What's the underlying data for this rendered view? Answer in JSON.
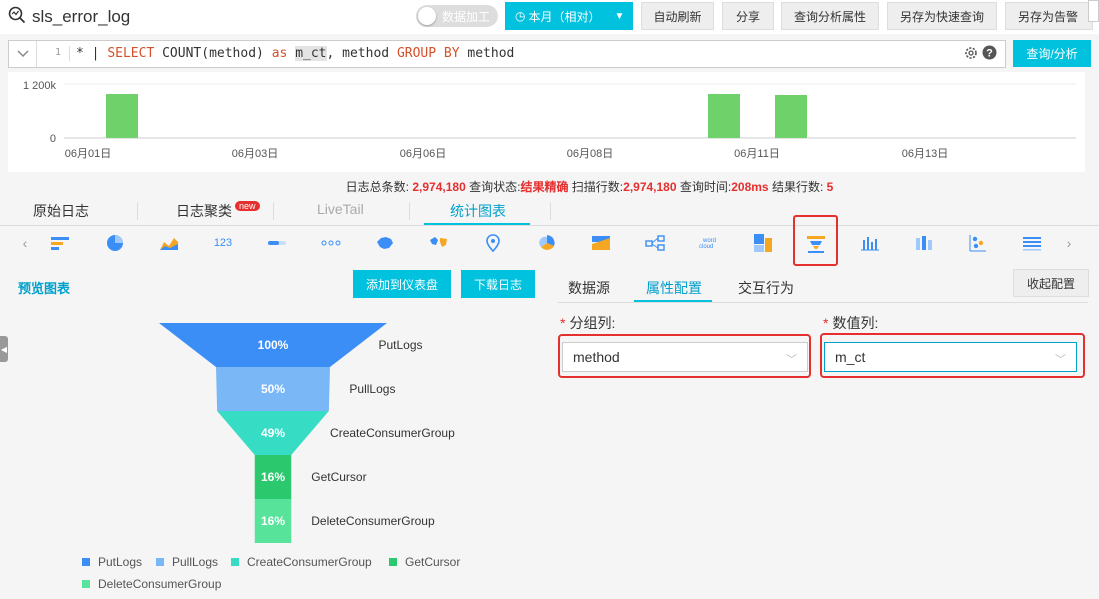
{
  "app": {
    "logstore_name": "sls_error_log",
    "data_process_label": "数据加工",
    "time_range_label": "本月（相对）",
    "buttons": {
      "auto_refresh": "自动刷新",
      "share": "分享",
      "query_props": "查询分析属性",
      "save_quick_query": "另存为快速查询",
      "save_alert": "另存为告警"
    }
  },
  "query": {
    "line_number": "1",
    "parts": {
      "star": "* | ",
      "select": "SELECT ",
      "count": "COUNT",
      "method_arg": "(method) ",
      "as": "as",
      "space1": " ",
      "alias": "m_ct",
      "rest": ", method ",
      "groupby": "GROUP BY",
      "tail": " method"
    },
    "submit_label": "查询/分析"
  },
  "histogram": {
    "y_ticks": [
      "1 200k",
      "0"
    ],
    "x_ticks": [
      "06月01日",
      "06月03日",
      "06月06日",
      "06月08日",
      "06月11日",
      "06月13日"
    ],
    "bar_color": "#6fd16a"
  },
  "summary": {
    "total_label": "日志总条数:",
    "total_value": "2,974,180",
    "status_label": "查询状态:",
    "status_value": "结果精确",
    "scan_label": "扫描行数:",
    "scan_value": "2,974,180",
    "time_label": "查询时间:",
    "time_value": "208ms",
    "rows_label": "结果行数:",
    "rows_value": "5"
  },
  "tabs": {
    "raw_logs": "原始日志",
    "log_cluster": "日志聚类",
    "new_badge": "new",
    "livetail": "LiveTail",
    "stats_chart": "统计图表"
  },
  "chart_icons": [
    "table-chart-icon",
    "pie-chart-icon",
    "area-chart-icon",
    "number-chart-icon",
    "progress-bar-icon",
    "flow-chart-icon",
    "china-map-icon",
    "world-map-icon",
    "amap-icon",
    "rose-chart-icon",
    "sankey-icon",
    "tree-icon",
    "word-cloud-icon",
    "treemap-icon",
    "funnel-chart-icon",
    "bar-chart-icon",
    "column-chart-icon",
    "scatter-icon",
    "list-icon"
  ],
  "preview": {
    "title": "预览图表",
    "add_dashboard": "添加到仪表盘",
    "download_logs": "下载日志"
  },
  "chart_data": {
    "type": "funnel",
    "categories": [
      "PutLogs",
      "PullLogs",
      "CreateConsumerGroup",
      "GetCursor",
      "DeleteConsumerGroup"
    ],
    "percent_labels": [
      "100%",
      "50%",
      "49%",
      "16%",
      "16%"
    ],
    "values": [
      100,
      50,
      49,
      16,
      16
    ],
    "colors": [
      "#3a8ef6",
      "#7ab7f7",
      "#36dcc4",
      "#2bc86e",
      "#58e39a"
    ],
    "legend_position": "bottom"
  },
  "config": {
    "tabs": [
      "数据源",
      "属性配置",
      "交互行为"
    ],
    "collapse_label": "收起配置",
    "group_label": "分组列:",
    "value_label": "数值列:",
    "group_value": "method",
    "value_value": "m_ct"
  }
}
